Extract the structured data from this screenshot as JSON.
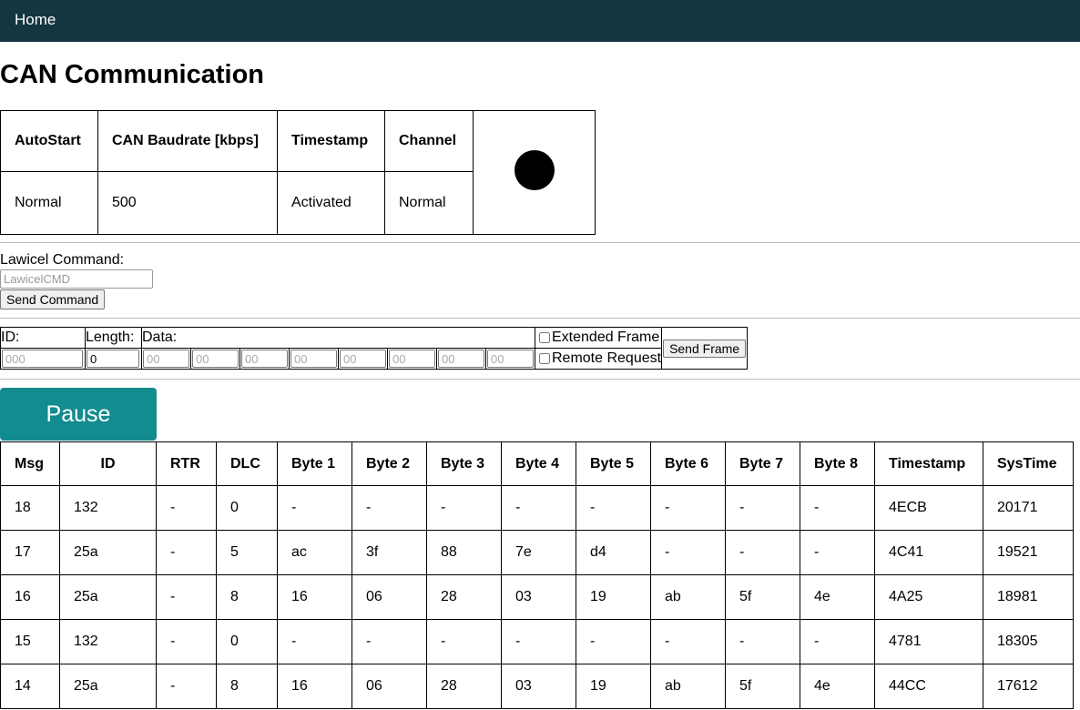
{
  "nav": {
    "home": "Home"
  },
  "page": {
    "title": "CAN Communication"
  },
  "status": {
    "headers": [
      "AutoStart",
      "CAN Baudrate [kbps]",
      "Timestamp",
      "Channel"
    ],
    "values": [
      "Normal",
      "500",
      "Activated",
      "Normal"
    ],
    "led_color": "#000000"
  },
  "lawicel": {
    "label": "Lawicel Command:",
    "placeholder": "LawicelCMD",
    "button": "Send Command"
  },
  "frame": {
    "id_label": "ID:",
    "length_label": "Length:",
    "data_label": "Data:",
    "id_placeholder": "000",
    "length_value": "0",
    "data_placeholder": "00",
    "extended_label": "Extended Frame",
    "remote_label": "Remote Request",
    "send_button": "Send Frame"
  },
  "pause": {
    "label": "Pause",
    "color": "#138c8f"
  },
  "messages": {
    "headers": [
      "Msg",
      "ID",
      "RTR",
      "DLC",
      "Byte 1",
      "Byte 2",
      "Byte 3",
      "Byte 4",
      "Byte 5",
      "Byte 6",
      "Byte 7",
      "Byte 8",
      "Timestamp",
      "SysTime"
    ],
    "rows": [
      [
        "18",
        "132",
        "-",
        "0",
        "-",
        "-",
        "-",
        "-",
        "-",
        "-",
        "-",
        "-",
        "4ECB",
        "20171"
      ],
      [
        "17",
        "25a",
        "-",
        "5",
        "ac",
        "3f",
        "88",
        "7e",
        "d4",
        "-",
        "-",
        "-",
        "4C41",
        "19521"
      ],
      [
        "16",
        "25a",
        "-",
        "8",
        "16",
        "06",
        "28",
        "03",
        "19",
        "ab",
        "5f",
        "4e",
        "4A25",
        "18981"
      ],
      [
        "15",
        "132",
        "-",
        "0",
        "-",
        "-",
        "-",
        "-",
        "-",
        "-",
        "-",
        "-",
        "4781",
        "18305"
      ],
      [
        "14",
        "25a",
        "-",
        "8",
        "16",
        "06",
        "28",
        "03",
        "19",
        "ab",
        "5f",
        "4e",
        "44CC",
        "17612"
      ]
    ]
  }
}
